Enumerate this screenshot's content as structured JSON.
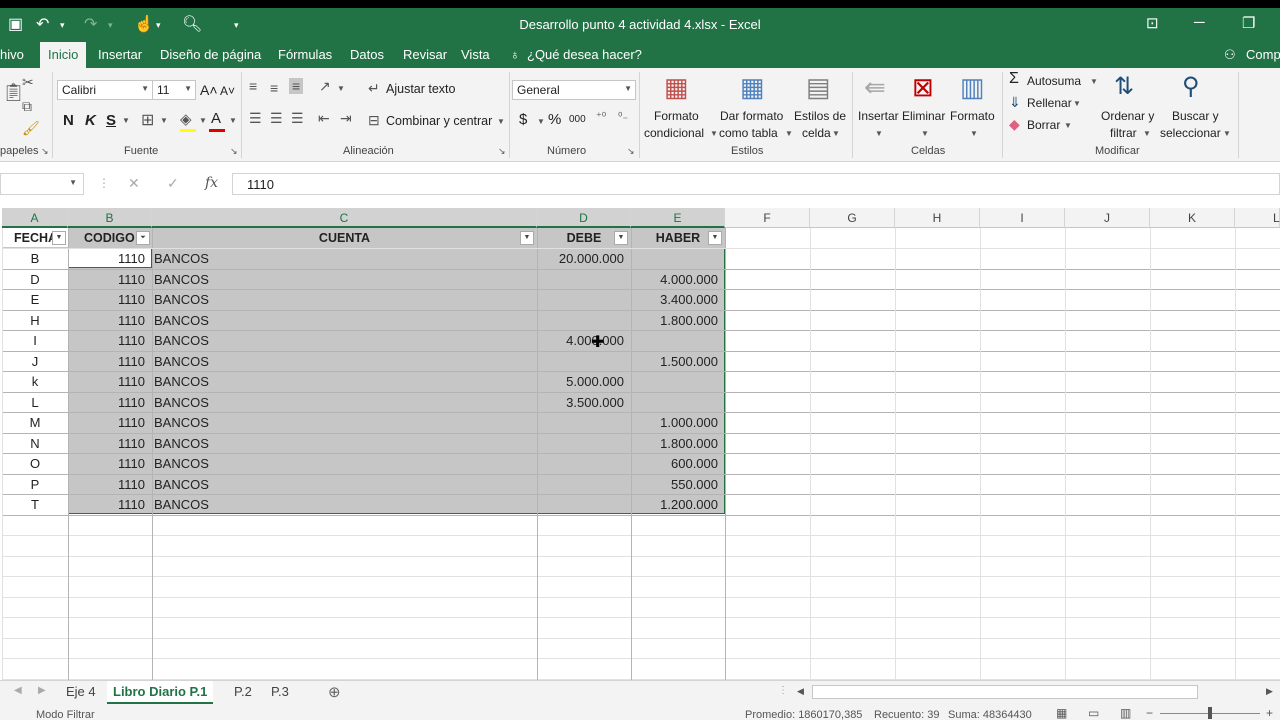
{
  "window": {
    "title": "Desarrollo punto 4 actividad 4.xlsx - Excel"
  },
  "ribbon_tabs": [
    "hivo",
    "Inicio",
    "Insertar",
    "Diseño de página",
    "Fórmulas",
    "Datos",
    "Revisar",
    "Vista"
  ],
  "tell_me": "¿Qué desea hacer?",
  "share_label": "Comp",
  "ribbon": {
    "font_name": "Calibri",
    "font_size": "11",
    "bold": "N",
    "italic": "K",
    "underline": "S",
    "wrap_text": "Ajustar texto",
    "merge_center": "Combinar y centrar",
    "number_format": "General",
    "currency": "$",
    "percent": "%",
    "thousands": "000",
    "cond_format_1": "Formato",
    "cond_format_2": "condicional",
    "table_format_1": "Dar formato",
    "table_format_2": "como tabla",
    "cell_styles_1": "Estilos de",
    "cell_styles_2": "celda",
    "insert": "Insertar",
    "delete": "Eliminar",
    "format": "Formato",
    "autosum": "Autosuma",
    "fill": "Rellenar",
    "clear": "Borrar",
    "sort_1": "Ordenar y",
    "sort_2": "filtrar",
    "find_1": "Buscar y",
    "find_2": "seleccionar",
    "groups": {
      "clipboard": "papeles",
      "font": "Fuente",
      "alignment": "Alineación",
      "number": "Número",
      "styles": "Estilos",
      "cells": "Celdas",
      "editing": "Modificar"
    }
  },
  "formula_bar": {
    "fx": "fx",
    "value": "1110"
  },
  "columns": [
    "A",
    "B",
    "C",
    "D",
    "E",
    "F",
    "G",
    "H",
    "I",
    "J",
    "K",
    "L"
  ],
  "table_headers": [
    "FECHA",
    "CODIGO",
    "CUENTA",
    "DEBE",
    "HABER"
  ],
  "rows": [
    {
      "fecha": "B",
      "codigo": "1110",
      "cuenta": "BANCOS",
      "debe": "20.000.000",
      "haber": ""
    },
    {
      "fecha": "D",
      "codigo": "1110",
      "cuenta": "BANCOS",
      "debe": "",
      "haber": "4.000.000"
    },
    {
      "fecha": "E",
      "codigo": "1110",
      "cuenta": "BANCOS",
      "debe": "",
      "haber": "3.400.000"
    },
    {
      "fecha": "H",
      "codigo": "1110",
      "cuenta": "BANCOS",
      "debe": "",
      "haber": "1.800.000"
    },
    {
      "fecha": "I",
      "codigo": "1110",
      "cuenta": "BANCOS",
      "debe": "4.000.000",
      "haber": ""
    },
    {
      "fecha": "J",
      "codigo": "1110",
      "cuenta": "BANCOS",
      "debe": "",
      "haber": "1.500.000"
    },
    {
      "fecha": "k",
      "codigo": "1110",
      "cuenta": "BANCOS",
      "debe": "5.000.000",
      "haber": ""
    },
    {
      "fecha": "L",
      "codigo": "1110",
      "cuenta": "BANCOS",
      "debe": "3.500.000",
      "haber": ""
    },
    {
      "fecha": "M",
      "codigo": "1110",
      "cuenta": "BANCOS",
      "debe": "",
      "haber": "1.000.000"
    },
    {
      "fecha": "N",
      "codigo": "1110",
      "cuenta": "BANCOS",
      "debe": "",
      "haber": "1.800.000"
    },
    {
      "fecha": "O",
      "codigo": "1110",
      "cuenta": "BANCOS",
      "debe": "",
      "haber": "600.000"
    },
    {
      "fecha": "P",
      "codigo": "1110",
      "cuenta": "BANCOS",
      "debe": "",
      "haber": "550.000"
    },
    {
      "fecha": "T",
      "codigo": "1110",
      "cuenta": "BANCOS",
      "debe": "",
      "haber": "1.200.000"
    }
  ],
  "sheets": [
    "Eje 4",
    "Libro Diario P.1",
    "P.2",
    "P.3"
  ],
  "active_sheet": "Libro Diario P.1",
  "status": {
    "mode": "Modo Filtrar",
    "average": "Promedio: 1860170,385",
    "count": "Recuento: 39",
    "sum": "Suma: 48364430"
  },
  "colors": {
    "excel_green": "#217346",
    "selection_fill": "#c6c6c6"
  }
}
